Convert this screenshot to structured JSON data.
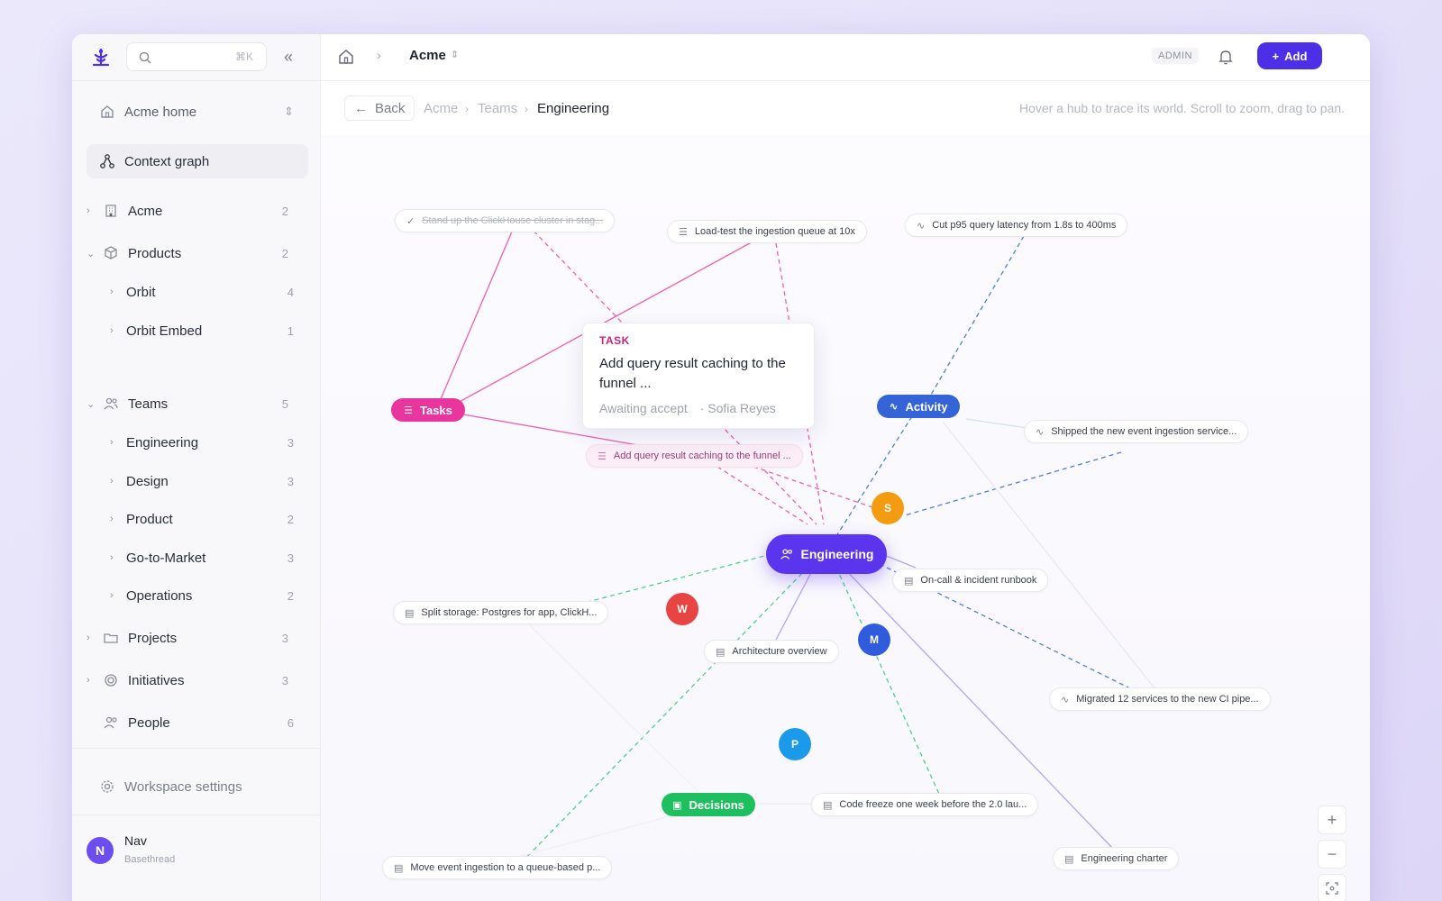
{
  "sidebar": {
    "search_shortcut": "⌘K",
    "home": {
      "label": "Acme home"
    },
    "context_graph": {
      "label": "Context graph"
    },
    "acme": {
      "label": "Acme",
      "count": "2"
    },
    "products": {
      "label": "Products",
      "count": "2"
    },
    "orbit": {
      "label": "Orbit",
      "count": "4"
    },
    "orbit_embed": {
      "label": "Orbit Embed",
      "count": "1"
    },
    "teams": {
      "label": "Teams",
      "count": "5"
    },
    "engineering": {
      "label": "Engineering",
      "count": "3"
    },
    "design": {
      "label": "Design",
      "count": "3"
    },
    "product": {
      "label": "Product",
      "count": "2"
    },
    "gtm": {
      "label": "Go-to-Market",
      "count": "3"
    },
    "operations": {
      "label": "Operations",
      "count": "2"
    },
    "projects": {
      "label": "Projects",
      "count": "3"
    },
    "initiatives": {
      "label": "Initiatives",
      "count": "3"
    },
    "people": {
      "label": "People",
      "count": "6"
    },
    "settings": {
      "label": "Workspace settings"
    },
    "user": {
      "initial": "N",
      "name": "Nav",
      "org": "Basethread"
    }
  },
  "topbar": {
    "workspace": "Acme",
    "admin": "ADMIN",
    "add_label": "Add"
  },
  "subbar": {
    "back_label": "Back",
    "breadcrumb": [
      "Acme",
      "Teams",
      "Engineering"
    ],
    "hint": "Hover a hub to trace its world. Scroll to zoom, drag to pan."
  },
  "graph": {
    "center": "Engineering",
    "hubs": {
      "tasks": "Tasks",
      "activity": "Activity",
      "decisions": "Decisions"
    },
    "people": {
      "s": "S",
      "w": "W",
      "m": "M",
      "p": "P"
    },
    "nodes": {
      "stand_up": "Stand up the ClickHouse cluster in stag...",
      "load_test": "Load-test the ingestion queue at 10x",
      "cut_p95": "Cut p95 query latency from 1.8s to 400ms",
      "shipped": "Shipped the new event ingestion service...",
      "caching": "Add query result caching to the funnel ...",
      "runbook": "On-call & incident runbook",
      "split_storage": "Split storage: Postgres for app, ClickH...",
      "arch": "Architecture overview",
      "migrated": "Migrated 12 services to the new CI pipe...",
      "code_freeze": "Code freeze one week before the 2.0 lau...",
      "charter": "Engineering charter",
      "move_ingest": "Move event ingestion to a queue-based p..."
    },
    "colors": {
      "engineering": "#5b34ee",
      "tasks": "#e8369e",
      "activity": "#3564d8",
      "decisions": "#1fbf5f",
      "s": "#f39c12",
      "w": "#e84444",
      "m": "#2f5bdc",
      "p": "#1a9ae8"
    }
  },
  "popup": {
    "kind": "TASK",
    "title": "Add query result caching to the funnel ...",
    "status": "Awaiting accept",
    "owner": "· Sofia Reyes"
  },
  "zoom": {
    "plus": "+",
    "minus": "−"
  }
}
